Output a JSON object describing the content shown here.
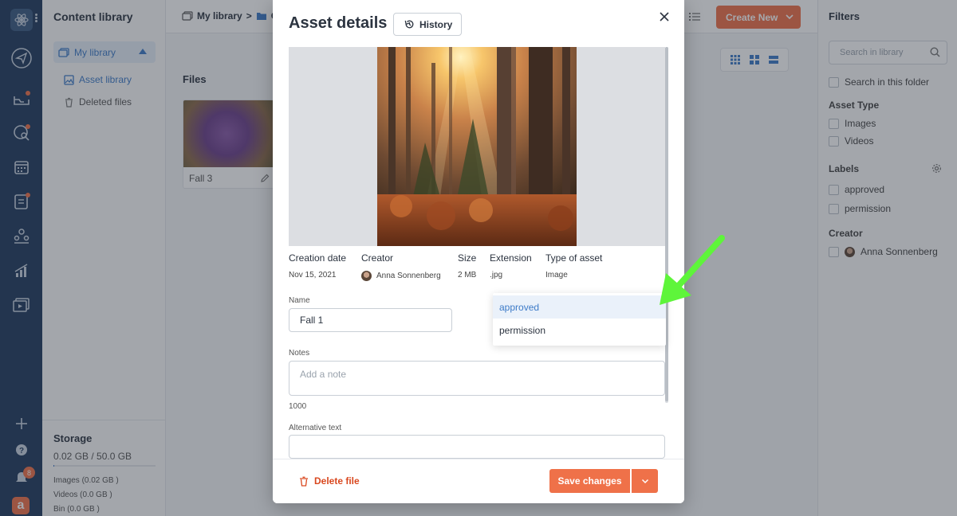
{
  "app": {
    "library_title": "Content library",
    "my_library": "My library",
    "nav": [
      {
        "label": "Asset library",
        "icon": "image-icon"
      },
      {
        "label": "Deleted files",
        "icon": "trash-icon"
      }
    ],
    "storage": {
      "title": "Storage",
      "used": "0.02 GB / 50.0 GB",
      "breakdown": [
        "Images (0.02 GB )",
        "Videos (0.0 GB )",
        "Bin (0.0 GB )"
      ]
    },
    "notification_count": "8",
    "rail_logo_letter": "a"
  },
  "main": {
    "breadcrumb_root": "My library",
    "breadcrumb_folder": "C",
    "create_button": "Create New",
    "files_heading": "Files",
    "card": {
      "caption": "Fall 3"
    }
  },
  "filters": {
    "title": "Filters",
    "search_placeholder": "Search in library",
    "search_in_folder": "Search in this folder",
    "asset_type_heading": "Asset Type",
    "asset_types": [
      "Images",
      "Videos"
    ],
    "labels_heading": "Labels",
    "labels": [
      "approved",
      "permission"
    ],
    "creator_heading": "Creator",
    "creator": "Anna Sonnenberg"
  },
  "modal": {
    "title": "Asset details",
    "history_button": "History",
    "meta": [
      {
        "key": "Creation date",
        "value": "Nov 15, 2021"
      },
      {
        "key": "Creator",
        "value": "Anna Sonnenberg"
      },
      {
        "key": "Size",
        "value": "2 MB"
      },
      {
        "key": "Extension",
        "value": ".jpg"
      },
      {
        "key": "Type of asset",
        "value": "Image"
      }
    ],
    "name_label": "Name",
    "name_value": "Fall 1",
    "notes_label": "Notes",
    "notes_placeholder": "Add a note",
    "notes_count": "1000",
    "alt_label": "Alternative text",
    "dropdown_options": [
      "approved",
      "permission"
    ],
    "delete_button": "Delete file",
    "save_button": "Save changes"
  },
  "colors": {
    "accent": "#ef7149",
    "link": "#3d7bc8",
    "rail": "#1f3a5e",
    "danger": "#d9481f",
    "arrow": "#5ef53a"
  }
}
